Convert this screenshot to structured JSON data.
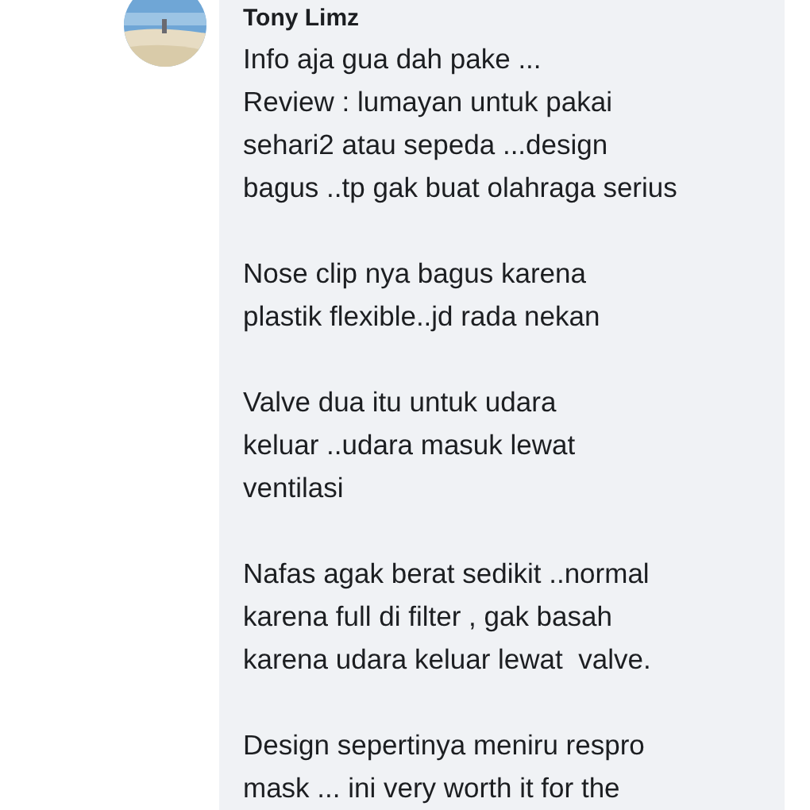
{
  "comment": {
    "author": "Tony Limz",
    "paragraphs": [
      {
        "lines": [
          "Info aja gua dah pake ...",
          "Review : lumayan untuk pakai",
          "sehari2 atau sepeda ...design",
          "bagus ..tp gak buat olahraga serius"
        ]
      },
      {
        "lines": [
          "Nose clip nya bagus karena",
          "plastik flexible..jd rada nekan"
        ]
      },
      {
        "lines": [
          "Valve dua itu untuk udara",
          "keluar ..udara masuk lewat",
          "ventilasi"
        ]
      },
      {
        "lines": [
          "Nafas agak berat sedikit ..normal",
          "karena full di filter , gak basah",
          "karena udara keluar lewat  valve."
        ]
      },
      {
        "lines": [
          "Design sepertinya meniru respro",
          "mask ... ini very worth it for the"
        ]
      }
    ]
  }
}
